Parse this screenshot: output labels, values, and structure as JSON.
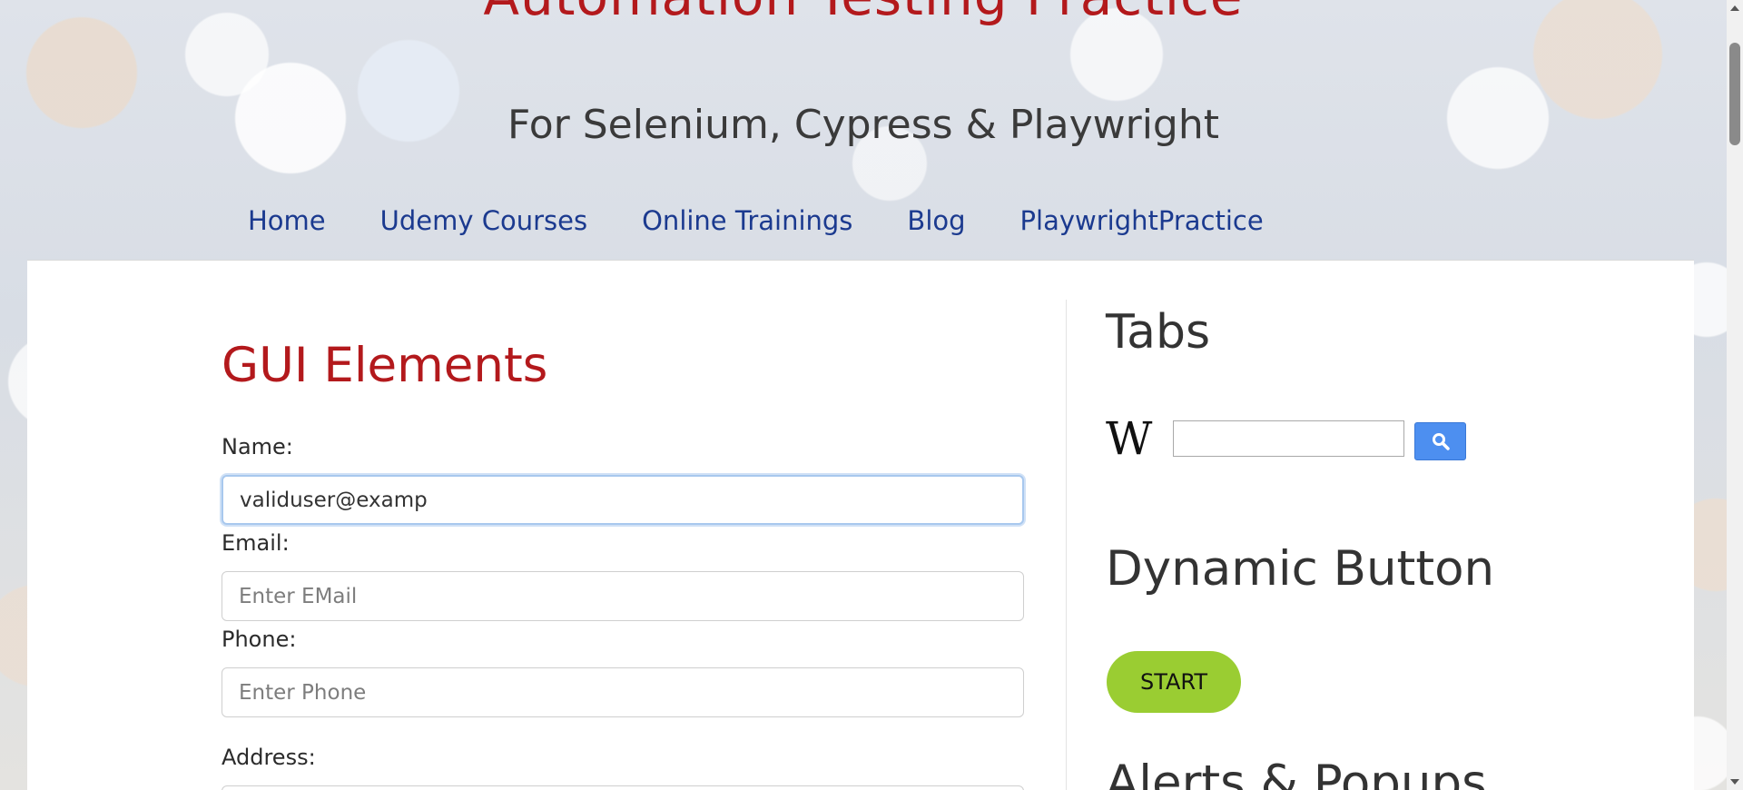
{
  "header": {
    "site_title": "Automation Testing Practice",
    "subtitle": "For Selenium, Cypress & Playwright"
  },
  "nav": {
    "items": [
      {
        "label": "Home"
      },
      {
        "label": "Udemy Courses"
      },
      {
        "label": "Online Trainings"
      },
      {
        "label": "Blog"
      },
      {
        "label": "PlaywrightPractice"
      }
    ]
  },
  "main": {
    "title": "GUI Elements",
    "name_label": "Name:",
    "name_value": "validuser@examp",
    "email_label": "Email:",
    "email_placeholder": "Enter EMail",
    "phone_label": "Phone:",
    "phone_placeholder": "Enter Phone",
    "address_label": "Address:"
  },
  "sidebar": {
    "tabs_title": "Tabs",
    "wiki_logo": "W",
    "wiki_search_value": "",
    "dynamic_button_title": "Dynamic Button",
    "start_button_label": "START",
    "alerts_title": "Alerts & Popups"
  },
  "colors": {
    "accent_red": "#b3191c",
    "nav_blue": "#1b3a8f",
    "start_green": "#9acd32",
    "search_blue": "#4d8ff0"
  }
}
